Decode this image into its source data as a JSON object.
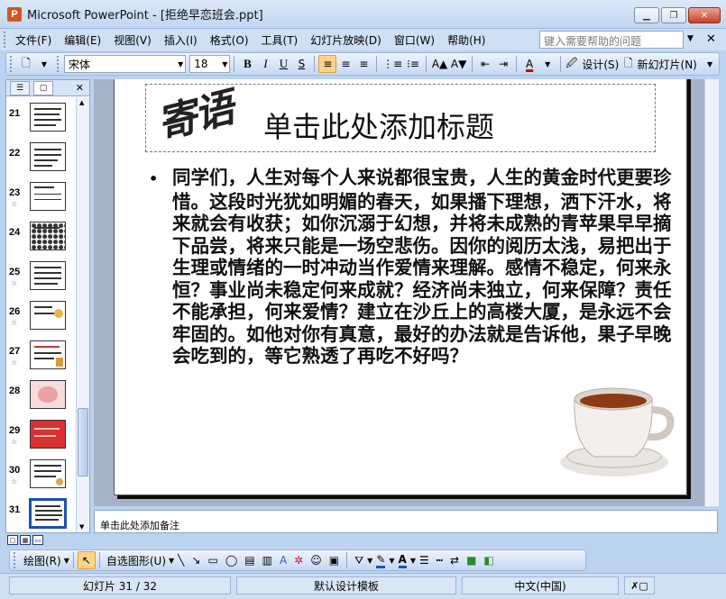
{
  "window": {
    "title": "Microsoft PowerPoint - [拒绝早恋班会.ppt]",
    "app_icon": "powerpoint-icon",
    "controls": [
      "minimize-icon",
      "restore-icon",
      "close-icon"
    ]
  },
  "menubar": {
    "items": [
      {
        "label": "文件(F)"
      },
      {
        "label": "编辑(E)"
      },
      {
        "label": "视图(V)"
      },
      {
        "label": "插入(I)"
      },
      {
        "label": "格式(O)"
      },
      {
        "label": "工具(T)"
      },
      {
        "label": "幻灯片放映(D)"
      },
      {
        "label": "窗口(W)"
      },
      {
        "label": "帮助(H)"
      }
    ],
    "help_placeholder": "键入需要帮助的问题"
  },
  "toolbar": {
    "font_name": "宋体",
    "font_size": "18",
    "bold": "B",
    "italic": "I",
    "underline": "U",
    "shadow": "S",
    "design_label": "设计(S)",
    "new_slide_label": "新幻灯片(N)"
  },
  "outline_pane": {
    "thumbnails": [
      {
        "num": "21"
      },
      {
        "num": "22"
      },
      {
        "num": "23"
      },
      {
        "num": "24"
      },
      {
        "num": "25"
      },
      {
        "num": "26"
      },
      {
        "num": "27"
      },
      {
        "num": "28"
      },
      {
        "num": "29"
      },
      {
        "num": "30"
      },
      {
        "num": "31"
      }
    ]
  },
  "slide": {
    "wordart": "寄语",
    "title_placeholder": "单击此处添加标题",
    "body": "同学们，人生对每个人来说都很宝贵，人生的黄金时代更要珍惜。这段时光犹如明媚的春天，如果播下理想，洒下汗水，将来就会有收获；如你沉溺于幻想，并将未成熟的青苹果早早摘下品尝，将来只能是一场空悲伤。因你的阅历太浅，易把出于生理或情绪的一时冲动当作爱情来理解。感情不稳定，何来永恒？事业尚未稳定何来成就？经济尚未独立，何来保障？责任不能承担，何来爱情？建立在沙丘上的高楼大厦，是永远不会牢固的。如他对你有真意，最好的办法就是告诉他，果子早晚会吃到的，等它熟透了再吃不好吗？"
  },
  "notes": {
    "placeholder": "单击此处添加备注"
  },
  "drawbar": {
    "draw_label": "绘图(R)",
    "autoshape_label": "自选图形(U)"
  },
  "status": {
    "slide_pos": "幻灯片 31 / 32",
    "template": "默认设计模板",
    "language": "中文(中国)"
  }
}
